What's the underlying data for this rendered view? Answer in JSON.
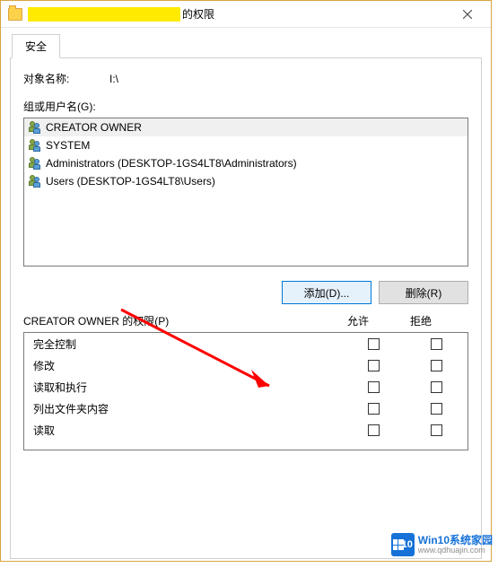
{
  "title_suffix": "的权限",
  "close_icon_name": "close-icon",
  "tab": {
    "security": "安全"
  },
  "object": {
    "label": "对象名称:",
    "value": "I:\\"
  },
  "groups": {
    "label": "组或用户名(G):",
    "items": [
      {
        "name": "CREATOR OWNER"
      },
      {
        "name": "SYSTEM"
      },
      {
        "name": "Administrators (DESKTOP-1GS4LT8\\Administrators)"
      },
      {
        "name": "Users (DESKTOP-1GS4LT8\\Users)"
      }
    ]
  },
  "buttons": {
    "add": "添加(D)...",
    "remove": "删除(R)"
  },
  "perms": {
    "header_label": "CREATOR OWNER 的权限(P)",
    "allow": "允许",
    "deny": "拒绝",
    "rows": [
      "完全控制",
      "修改",
      "读取和执行",
      "列出文件夹内容",
      "读取"
    ]
  },
  "watermark": {
    "line1": "Win10系统家园",
    "line2": "www.qdhuajin.com"
  }
}
